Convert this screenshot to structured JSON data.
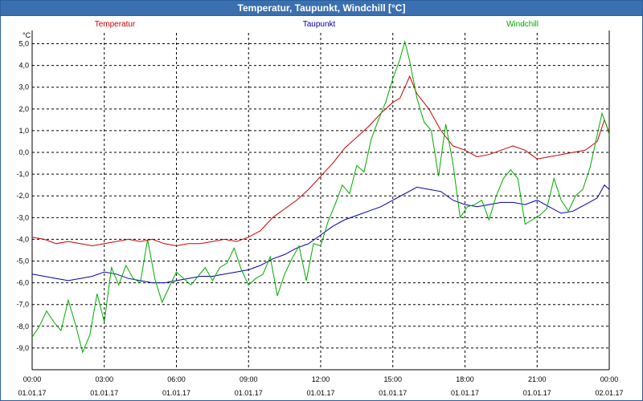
{
  "window": {
    "title": "Temperatur, Taupunkt, Windchill [°C]"
  },
  "colors": {
    "titlebar": "#3a6fb0",
    "temperatur": "#cc0000",
    "taupunkt": "#0000aa",
    "windchill": "#00aa00",
    "grid": "#000000"
  },
  "chart_data": {
    "type": "line",
    "title": "Temperatur, Taupunkt, Windchill [°C]",
    "ylabel": "°C",
    "ylim": [
      -10.0,
      5.5
    ],
    "yticks": [
      "5,0",
      "4,0",
      "3,0",
      "2,0",
      "1,0",
      "0,0",
      "-1,0",
      "-2,0",
      "-3,0",
      "-4,0",
      "-5,0",
      "-6,0",
      "-7,0",
      "-8,0",
      "-9,0"
    ],
    "ytick_values": [
      5,
      4,
      3,
      2,
      1,
      0,
      -1,
      -2,
      -3,
      -4,
      -5,
      -6,
      -7,
      -8,
      -9
    ],
    "xlim": [
      0,
      24
    ],
    "xticks": [
      {
        "time": "00:00",
        "date": "01.01.17"
      },
      {
        "time": "03:00",
        "date": "01.01.17"
      },
      {
        "time": "06:00",
        "date": "01.01.17"
      },
      {
        "time": "09:00",
        "date": "01.01.17"
      },
      {
        "time": "12:00",
        "date": "01.01.17"
      },
      {
        "time": "15:00",
        "date": "01.01.17"
      },
      {
        "time": "18:00",
        "date": "01.01.17"
      },
      {
        "time": "21:00",
        "date": "01.01.17"
      },
      {
        "time": "00:00",
        "date": "02.01.17"
      }
    ],
    "xtick_values": [
      0,
      3,
      6,
      9,
      12,
      15,
      18,
      21,
      24
    ],
    "grid": true,
    "legend_position": "top",
    "series": [
      {
        "name": "Temperatur",
        "color": "#cc0000",
        "x": [
          0,
          0.5,
          1,
          1.5,
          2,
          2.5,
          3,
          3.5,
          4,
          4.5,
          5,
          5.5,
          6,
          6.5,
          7,
          7.5,
          8,
          8.5,
          9,
          9.5,
          10,
          10.5,
          11,
          11.5,
          12,
          12.5,
          13,
          13.5,
          14,
          14.5,
          15,
          15.3,
          15.7,
          16,
          16.5,
          17,
          17.5,
          18,
          18.5,
          19,
          19.5,
          20,
          20.5,
          21,
          21.5,
          22,
          22.5,
          23,
          23.5,
          23.8,
          24
        ],
        "y": [
          -3.9,
          -4.0,
          -4.2,
          -4.1,
          -4.2,
          -4.3,
          -4.2,
          -4.1,
          -4.0,
          -4.1,
          -4.0,
          -4.2,
          -4.3,
          -4.2,
          -4.2,
          -4.1,
          -4.0,
          -4.1,
          -3.9,
          -3.6,
          -3.0,
          -2.6,
          -2.2,
          -1.7,
          -1.1,
          -0.5,
          0.2,
          0.7,
          1.2,
          1.8,
          2.3,
          2.5,
          3.5,
          2.7,
          2.0,
          1.0,
          0.3,
          0.1,
          -0.2,
          -0.1,
          0.1,
          0.3,
          0.1,
          -0.3,
          -0.2,
          -0.1,
          0.0,
          0.1,
          0.5,
          1.5,
          0.9
        ]
      },
      {
        "name": "Taupunkt",
        "color": "#0000aa",
        "x": [
          0,
          0.5,
          1,
          1.5,
          2,
          2.5,
          3,
          3.5,
          4,
          4.5,
          5,
          5.5,
          6,
          6.5,
          7,
          7.5,
          8,
          8.5,
          9,
          9.5,
          10,
          10.5,
          11,
          11.5,
          12,
          12.5,
          13,
          13.5,
          14,
          14.5,
          15,
          15.5,
          16,
          16.5,
          17,
          17.5,
          18,
          18.5,
          19,
          19.5,
          20,
          20.5,
          21,
          21.5,
          22,
          22.5,
          23,
          23.5,
          23.8,
          24
        ],
        "y": [
          -5.6,
          -5.7,
          -5.8,
          -5.9,
          -5.8,
          -5.7,
          -5.5,
          -5.6,
          -5.8,
          -5.9,
          -6.0,
          -6.0,
          -5.9,
          -5.8,
          -5.7,
          -5.7,
          -5.6,
          -5.5,
          -5.4,
          -5.2,
          -4.9,
          -4.7,
          -4.4,
          -4.2,
          -3.8,
          -3.4,
          -3.1,
          -2.9,
          -2.7,
          -2.5,
          -2.2,
          -1.9,
          -1.6,
          -1.7,
          -1.8,
          -2.2,
          -2.4,
          -2.5,
          -2.4,
          -2.3,
          -2.3,
          -2.4,
          -2.2,
          -2.5,
          -2.8,
          -2.7,
          -2.4,
          -2.1,
          -1.5,
          -1.7
        ]
      },
      {
        "name": "Windchill",
        "color": "#00aa00",
        "x": [
          0,
          0.3,
          0.6,
          0.9,
          1.2,
          1.5,
          1.8,
          2.1,
          2.4,
          2.7,
          3,
          3.3,
          3.6,
          3.9,
          4.2,
          4.5,
          4.8,
          5.1,
          5.4,
          5.7,
          6,
          6.3,
          6.6,
          6.9,
          7.2,
          7.5,
          7.8,
          8.1,
          8.4,
          8.7,
          9,
          9.3,
          9.6,
          9.9,
          10.2,
          10.5,
          10.8,
          11.1,
          11.4,
          11.7,
          12,
          12.3,
          12.6,
          12.9,
          13.2,
          13.5,
          13.8,
          14.1,
          14.4,
          14.7,
          15,
          15.3,
          15.5,
          15.7,
          16,
          16.3,
          16.6,
          16.9,
          17.2,
          17.5,
          17.8,
          18.1,
          18.4,
          18.7,
          19,
          19.3,
          19.6,
          19.9,
          20.2,
          20.5,
          20.8,
          21.1,
          21.4,
          21.7,
          22,
          22.3,
          22.6,
          22.9,
          23.2,
          23.5,
          23.7,
          23.9,
          24
        ],
        "y": [
          -8.5,
          -8.0,
          -7.3,
          -7.8,
          -8.2,
          -6.8,
          -7.9,
          -9.2,
          -8.4,
          -6.5,
          -7.8,
          -5.3,
          -6.1,
          -5.2,
          -5.8,
          -6.0,
          -4.0,
          -5.8,
          -6.9,
          -6.2,
          -5.5,
          -5.8,
          -6.1,
          -5.7,
          -5.3,
          -5.9,
          -5.3,
          -5.1,
          -4.4,
          -5.4,
          -6.1,
          -5.8,
          -5.6,
          -4.8,
          -6.6,
          -5.6,
          -4.9,
          -4.3,
          -5.9,
          -4.2,
          -4.3,
          -3.2,
          -2.4,
          -1.5,
          -1.9,
          -0.6,
          -0.9,
          0.6,
          1.5,
          2.3,
          3.4,
          4.3,
          5.1,
          4.2,
          2.5,
          1.4,
          1.0,
          -1.1,
          1.3,
          -0.5,
          -3.0,
          -2.5,
          -2.4,
          -2.2,
          -3.1,
          -2.0,
          -1.2,
          -0.8,
          -1.2,
          -3.3,
          -3.1,
          -2.9,
          -2.6,
          -1.2,
          -2.2,
          -2.7,
          -2.0,
          -1.7,
          -0.7,
          0.8,
          1.8,
          1.2,
          0.8
        ]
      }
    ]
  }
}
